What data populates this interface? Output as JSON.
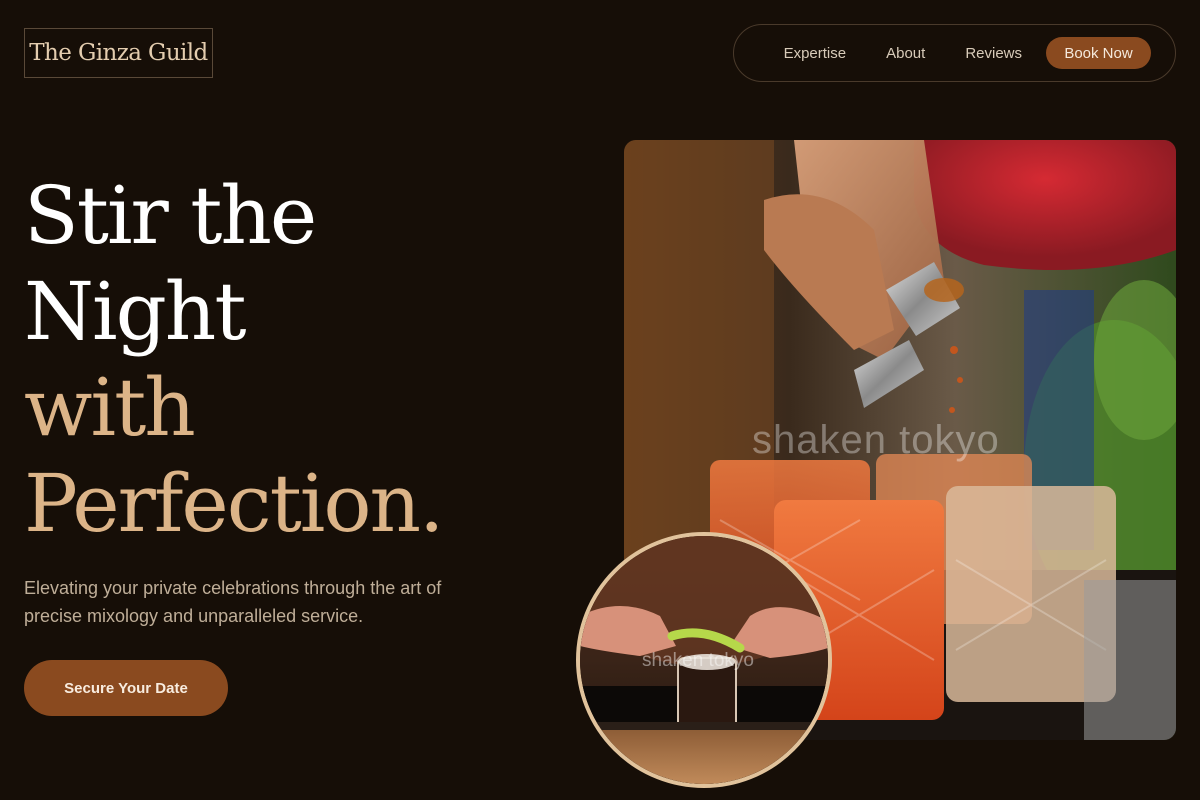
{
  "brand": {
    "name": "The Ginza Guild"
  },
  "nav": {
    "items": [
      {
        "label": "Expertise"
      },
      {
        "label": "About"
      },
      {
        "label": "Reviews"
      }
    ],
    "book_label": "Book Now"
  },
  "hero": {
    "title_lines": [
      "Stir the",
      "Night",
      "with",
      "Perfection."
    ],
    "subtitle": "Elevating your private celebrations through the art of precise mixology and unparalleled service.",
    "cta_label": "Secure Your Date"
  },
  "images": {
    "main_photo_subject": "bartender-pouring-jigger-into-glasses",
    "circle_photo_subject": "hands-garnishing-cocktail",
    "watermark_text": "shaken tokyo"
  },
  "colors": {
    "background": "#160e07",
    "accent": "#8a4a1f",
    "gold": "#dcb488",
    "logo_text": "#e4cdaf",
    "nav_text": "#d8cbb9",
    "subtitle_text": "#bfae98",
    "circle_border": "#e1c39c"
  }
}
